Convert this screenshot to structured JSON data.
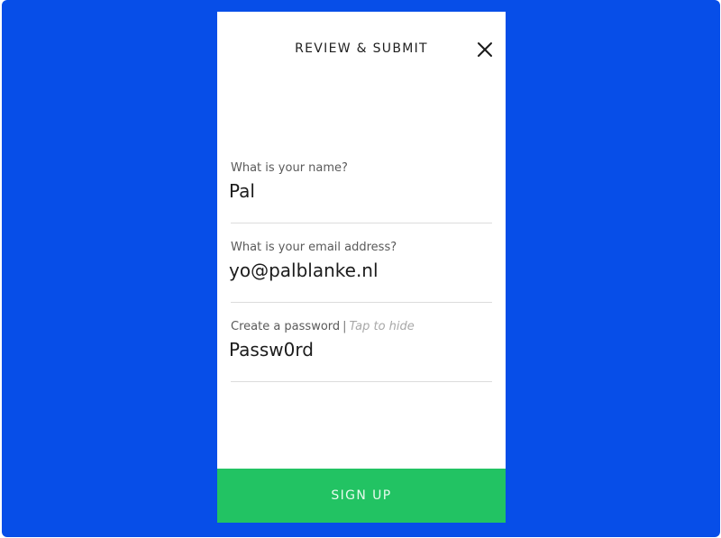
{
  "header": {
    "title": "REVIEW & SUBMIT"
  },
  "fields": {
    "name": {
      "label": "What is your name?",
      "value": "Pal"
    },
    "email": {
      "label": "What is your email address?",
      "value": "yo@palblanke.nl"
    },
    "password": {
      "label": "Create a password",
      "separator": "|",
      "toggle_hint": "Tap to hide",
      "value": "Passw0rd"
    }
  },
  "actions": {
    "signup_label": "SIGN UP"
  },
  "colors": {
    "background": "#074ee8",
    "primary_button": "#22c363",
    "card": "#ffffff"
  },
  "icons": {
    "close": "close-icon"
  }
}
